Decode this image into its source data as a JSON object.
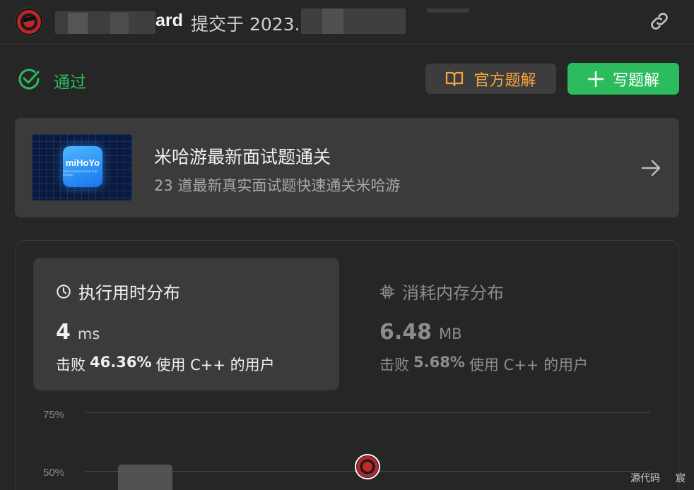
{
  "header": {
    "username_suffix": "ard",
    "submitted_text": "提交于 2023.",
    "avatar_icon": "user-avatar",
    "share_icon": "link-icon"
  },
  "status": {
    "label": "通过",
    "icon": "check-circle-icon",
    "color": "#2cbb5d"
  },
  "actions": {
    "official_solution": "官方题解",
    "official_icon": "book-icon",
    "write_solution": "写题解",
    "write_icon": "plus-icon"
  },
  "banner": {
    "title": "米哈游最新面试题通关",
    "subtitle": "23 道最新真实面试题快速通关米哈游",
    "logo_text": "miHoYo",
    "logo_subtext": "TECH OTAKUS SAVE THE WORLD",
    "arrow_icon": "arrow-right-icon"
  },
  "runtime": {
    "title": "执行用时分布",
    "icon": "clock-icon",
    "value": "4",
    "unit": "ms",
    "beat_prefix": "击败",
    "beat_percent": "46.36%",
    "beat_suffix": "使用 C++ 的用户"
  },
  "memory": {
    "title": "消耗内存分布",
    "icon": "chip-icon",
    "value": "6.48",
    "unit": "MB",
    "beat_prefix": "击败",
    "beat_percent": "5.68%",
    "beat_suffix": "使用 C++ 的用户"
  },
  "chart": {
    "ticks": [
      "75%",
      "50%"
    ],
    "marker_icon": "user-avatar-marker"
  },
  "footer": {
    "source_code": "源代码",
    "extra": "宸"
  },
  "colors": {
    "accent_green": "#2cbb5d",
    "accent_orange": "#f7a53c",
    "background": "#262626",
    "card": "#3b3b3b"
  }
}
